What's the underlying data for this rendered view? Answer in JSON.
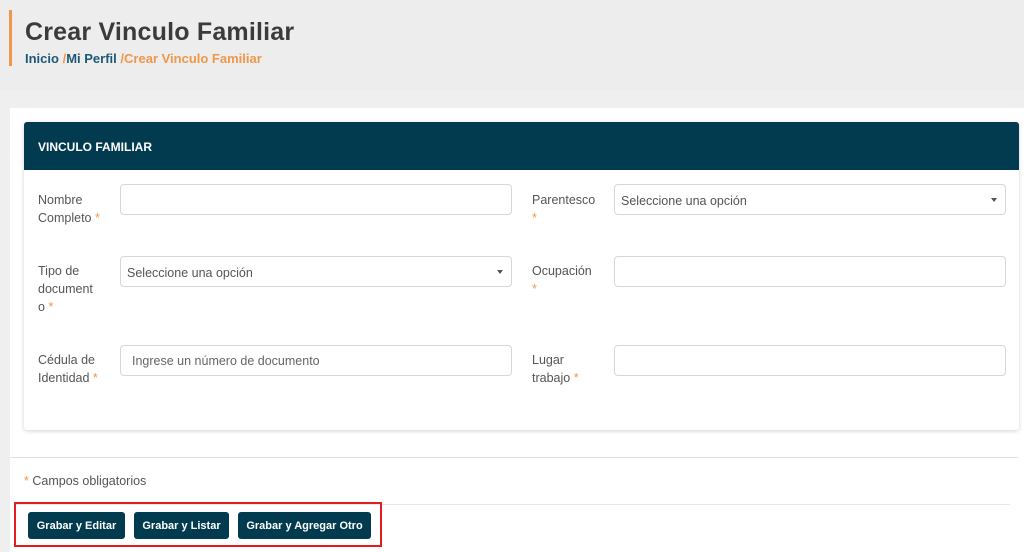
{
  "header": {
    "title": "Crear Vinculo Familiar",
    "breadcrumb": {
      "home": "Inicio",
      "separator": "/",
      "profile": "Mi Perfil",
      "current": "Crear Vinculo Familiar"
    }
  },
  "card": {
    "title": "VINCULO FAMILIAR",
    "required_mark": "*",
    "fields": {
      "nombre": {
        "label_line1": "Nombre",
        "label_line2": "Completo",
        "value": ""
      },
      "parentesco": {
        "label": "Parentesco",
        "value": "Seleccione una opción"
      },
      "tipo_documento": {
        "label_line1": "Tipo de",
        "label_line2": "document",
        "label_line3": "o",
        "value": "Seleccione una opción"
      },
      "ocupacion": {
        "label": "Ocupación",
        "value": ""
      },
      "cedula": {
        "label_line1": "Cédula de",
        "label_line2": "Identidad",
        "placeholder": "Ingrese un número de documento"
      },
      "lugar_trabajo": {
        "label_line1": "Lugar",
        "label_line2": "trabajo",
        "value": ""
      }
    }
  },
  "required_note": "Campos obligatorios",
  "actions": {
    "save_edit": "Grabar y Editar",
    "save_list": "Grabar y Listar",
    "save_add": "Grabar y Agregar Otro"
  },
  "colors": {
    "primary": "#023b50",
    "accent": "#f0974a",
    "highlight": "#e31b23"
  },
  "icons": [
    "chevron-down-icon"
  ]
}
